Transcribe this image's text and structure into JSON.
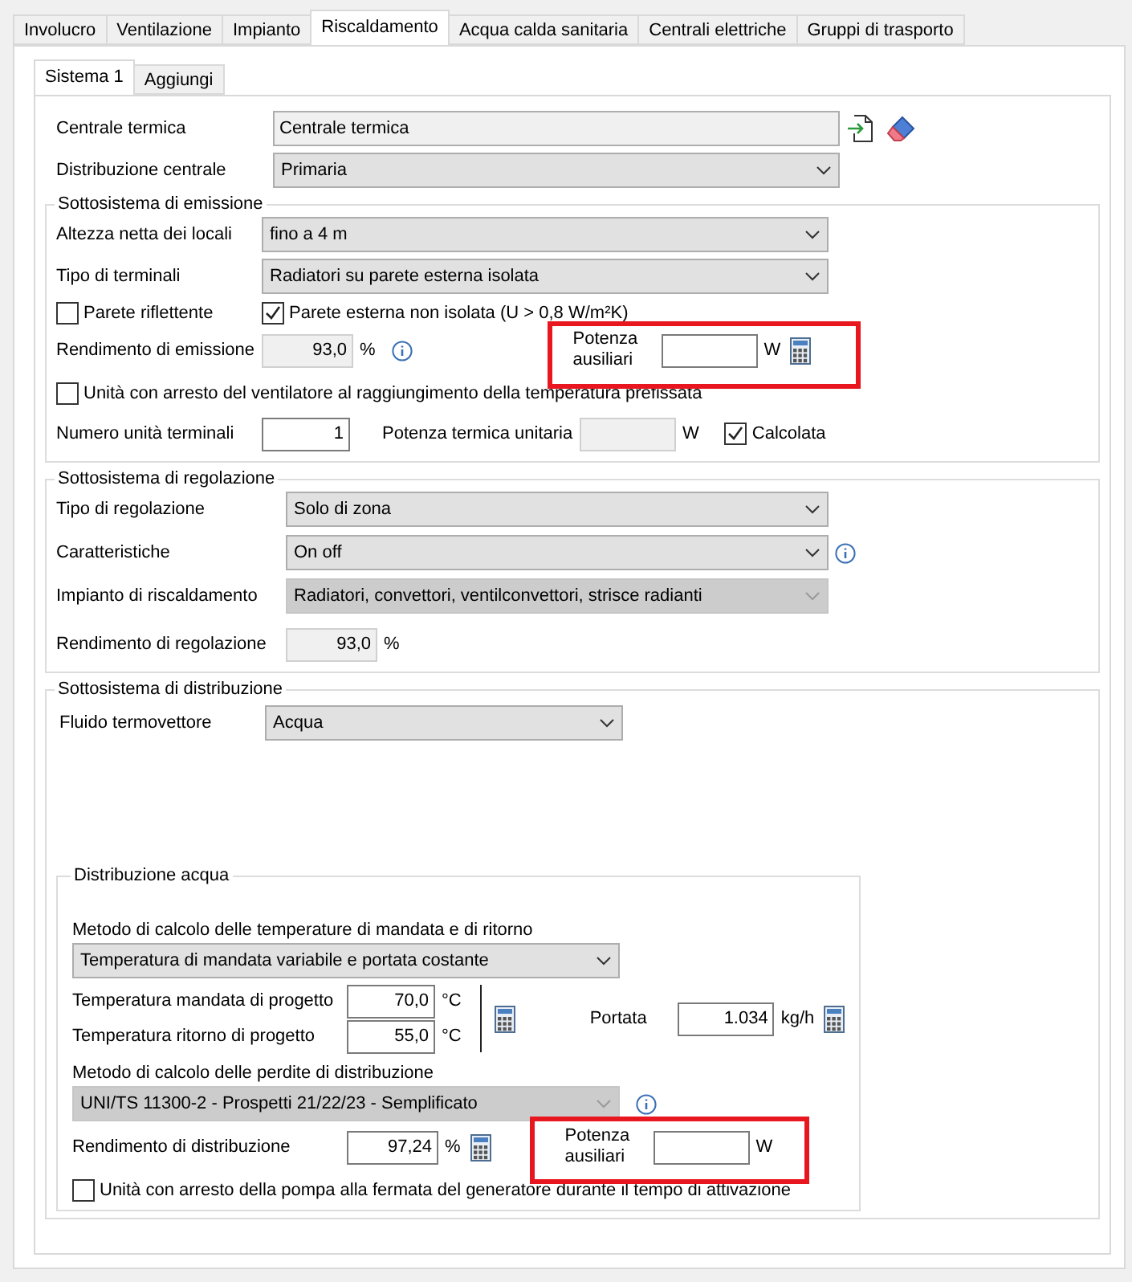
{
  "tabs": [
    {
      "label": "Involucro",
      "selected": false
    },
    {
      "label": "Ventilazione",
      "selected": false
    },
    {
      "label": "Impianto",
      "selected": false
    },
    {
      "label": "Riscaldamento",
      "selected": true
    },
    {
      "label": "Acqua calda sanitaria",
      "selected": false
    },
    {
      "label": "Centrali elettriche",
      "selected": false
    },
    {
      "label": "Gruppi di trasporto",
      "selected": false
    }
  ],
  "subtabs": [
    {
      "label": "Sistema 1",
      "selected": true
    },
    {
      "label": "Aggiungi",
      "selected": false
    }
  ],
  "header": {
    "centrale": {
      "label": "Centrale termica",
      "value": "Centrale termica"
    },
    "distribuzione": {
      "label": "Distribuzione centrale",
      "value": "Primaria",
      "disabled": false
    }
  },
  "emission": {
    "title": "Sottosistema di emissione",
    "altezza": {
      "label": "Altezza netta dei locali",
      "value": "fino a 4 m",
      "disabled": false
    },
    "terminali": {
      "label": "Tipo di terminali",
      "value": "Radiatori su parete esterna isolata",
      "disabled": false
    },
    "parete_riflettente": {
      "label": "Parete riflettente",
      "checked": false
    },
    "parete_esterna": {
      "label": "Parete esterna non isolata (U > 0,8 W/m²K)",
      "checked": true
    },
    "rendimento": {
      "label": "Rendimento di emissione",
      "value": "93,0",
      "unit": "%",
      "readonly": true
    },
    "aux_power": {
      "label": "Potenza ausiliari",
      "unit": "W",
      "highlighted": true
    },
    "arresto": {
      "label": "Unità con arresto del ventilatore al raggiungimento della temperatura prefissata",
      "checked": false
    },
    "numero": {
      "label": "Numero unità terminali",
      "value": "1",
      "readonly": false
    },
    "potenza_unitaria": {
      "label": "Potenza termica unitaria",
      "unit": "W",
      "readonly": true
    },
    "calcolata": {
      "label": "Calcolata",
      "checked": true
    }
  },
  "regulation": {
    "title": "Sottosistema di regolazione",
    "rows": [
      {
        "label": "Tipo di regolazione",
        "value": "Solo di zona",
        "disabled": false,
        "info": false
      },
      {
        "label": "Caratteristiche",
        "value": "On off",
        "disabled": false,
        "info": true
      },
      {
        "label": "Impianto di riscaldamento",
        "value": "Radiatori, convettori, ventilconvettori, strisce radianti",
        "disabled": true,
        "info": false
      }
    ],
    "rendimento": {
      "label": "Rendimento di regolazione",
      "value": "93,0",
      "unit": "%",
      "readonly": true
    }
  },
  "distribution": {
    "title": "Sottosistema di distribuzione",
    "fluido": {
      "label": "Fluido termovettore",
      "value": "Acqua",
      "disabled": false
    },
    "water": {
      "title": "Distribuzione acqua",
      "metodo_temp": {
        "label": "Metodo di calcolo delle temperature di mandata e di ritorno",
        "value": "Temperatura di mandata variabile e portata costante",
        "disabled": false
      },
      "mandata": {
        "label": "Temperatura mandata di progetto",
        "value": "70,0",
        "unit": "°C",
        "readonly": false
      },
      "ritorno": {
        "label": "Temperatura ritorno di progetto",
        "value": "55,0",
        "unit": "°C",
        "readonly": false
      },
      "portata": {
        "label": "Portata",
        "value": "1.034",
        "unit": "kg/h",
        "readonly": false
      },
      "metodo_perdite": {
        "label": "Metodo di calcolo delle perdite di distribuzione",
        "value": "UNI/TS 11300-2 - Prospetti 21/22/23 - Semplificato",
        "disabled": true
      },
      "rendimento": {
        "label": "Rendimento di distribuzione",
        "value": "97,24",
        "unit": "%",
        "readonly": false
      },
      "aux_power": {
        "label": "Potenza ausiliari",
        "unit": "W",
        "highlighted": true
      },
      "arresto": {
        "label": "Unità con arresto della pompa alla fermata del generatore durante il tempo di attivazione",
        "checked": false
      }
    }
  }
}
